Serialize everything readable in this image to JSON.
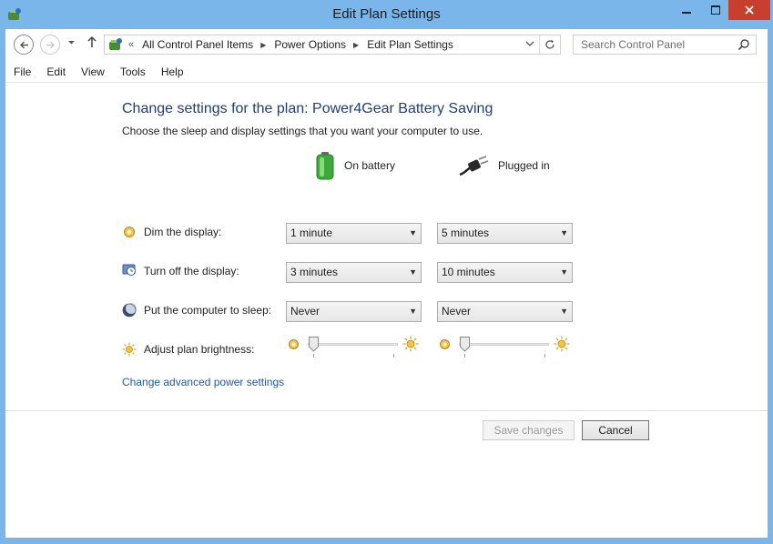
{
  "window": {
    "title": "Edit Plan Settings"
  },
  "nav": {
    "breadcrumbs": [
      "All Control Panel Items",
      "Power Options",
      "Edit Plan Settings"
    ],
    "search_placeholder": "Search Control Panel"
  },
  "menu": [
    "File",
    "Edit",
    "View",
    "Tools",
    "Help"
  ],
  "main": {
    "heading": "Change settings for the plan: Power4Gear Battery Saving",
    "subheading": "Choose the sleep and display settings that you want your computer to use.",
    "col_battery": "On battery",
    "col_plugged": "Plugged in",
    "rows": [
      {
        "label": "Dim the display:",
        "battery": "1 minute",
        "plugged": "5 minutes"
      },
      {
        "label": "Turn off the display:",
        "battery": "3 minutes",
        "plugged": "10 minutes"
      },
      {
        "label": "Put the computer to sleep:",
        "battery": "Never",
        "plugged": "Never"
      }
    ],
    "brightness_label": "Adjust plan brightness:",
    "brightness_battery_level": 0,
    "brightness_plugged_level": 0,
    "advanced_link": "Change advanced power settings"
  },
  "buttons": {
    "save": "Save changes",
    "cancel": "Cancel"
  },
  "colors": {
    "titlebar": "#7ab6ea",
    "close": "#c7402e",
    "heading": "#1e3e7a",
    "link": "#1c5a9c"
  }
}
